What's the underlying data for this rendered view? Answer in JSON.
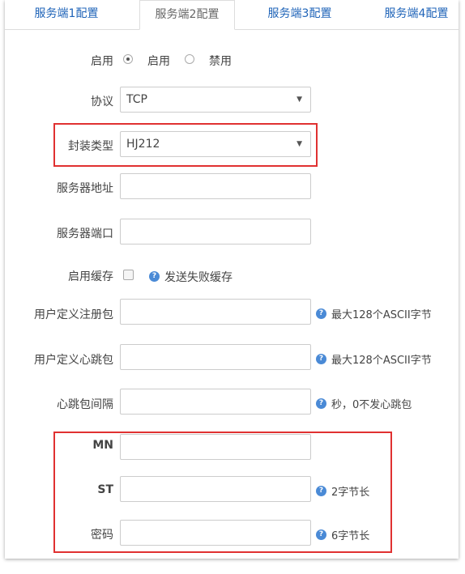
{
  "tabs": [
    {
      "label": "服务端1配置"
    },
    {
      "label": "服务端2配置"
    },
    {
      "label": "服务端3配置"
    },
    {
      "label": "服务端4配置"
    }
  ],
  "form": {
    "enable": {
      "label": "启用",
      "opt_on": "启用",
      "opt_off": "禁用"
    },
    "protocol": {
      "label": "协议",
      "value": "TCP"
    },
    "encap": {
      "label": "封装类型",
      "value": "HJ212"
    },
    "server_addr": {
      "label": "服务器地址",
      "value": ""
    },
    "server_port": {
      "label": "服务器端口",
      "value": ""
    },
    "cache": {
      "label": "启用缓存",
      "hint": "发送失败缓存"
    },
    "reg_packet": {
      "label": "用户定义注册包",
      "value": "",
      "hint": "最大128个ASCII字节"
    },
    "heartbeat_packet": {
      "label": "用户定义心跳包",
      "value": "",
      "hint": "最大128个ASCII字节"
    },
    "heartbeat_interval": {
      "label": "心跳包间隔",
      "value": "",
      "hint": "秒，0不发心跳包"
    },
    "mn": {
      "label": "MN",
      "value": ""
    },
    "st": {
      "label": "ST",
      "value": "",
      "hint": "2字节长"
    },
    "password": {
      "label": "密码",
      "value": "",
      "hint": "6字节长"
    }
  },
  "icons": {
    "help": "?"
  },
  "colors": {
    "accent": "#1e63b8",
    "highlight": "#e03131",
    "help_icon": "#4a8ad6"
  }
}
